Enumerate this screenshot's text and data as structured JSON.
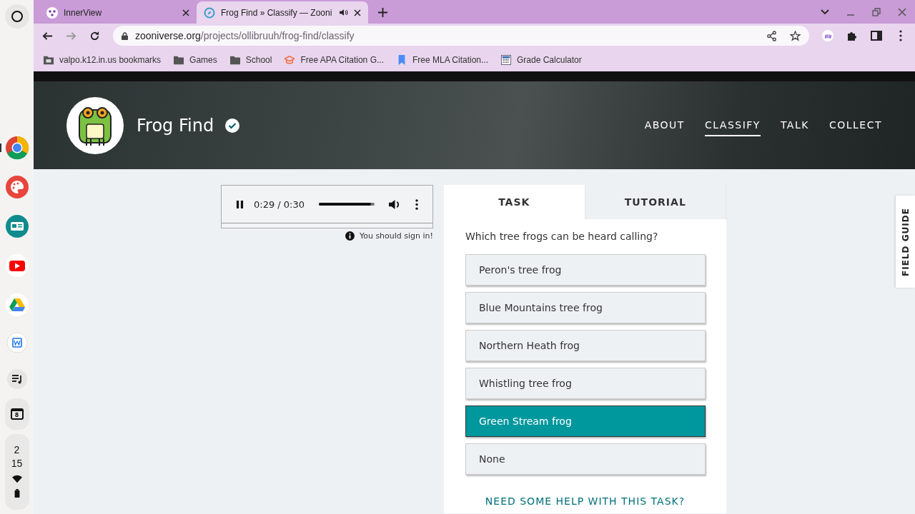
{
  "shelf": {
    "apps": [
      {
        "kind": "chrome",
        "active": true
      },
      {
        "kind": "paint",
        "active": false
      },
      {
        "kind": "news",
        "active": false
      },
      {
        "kind": "youtube",
        "active": false
      },
      {
        "kind": "drive",
        "active": false
      },
      {
        "kind": "doc",
        "active": false
      },
      {
        "kind": "playlist",
        "active": false
      }
    ],
    "calendar_day": "8",
    "clock": [
      "2",
      "15"
    ]
  },
  "browser": {
    "tabs": [
      {
        "title": "InnerView",
        "selected": false,
        "audio": false
      },
      {
        "title": "Frog Find » Classify — Zooni",
        "selected": true,
        "audio": true
      }
    ],
    "address": {
      "host": "zooniverse.org",
      "path": "/projects/ollibruuh/frog-find/classify"
    },
    "bookmarks": [
      {
        "kind": "page",
        "label": "valpo.k12.in.us bookmarks"
      },
      {
        "kind": "folder",
        "label": "Games"
      },
      {
        "kind": "folder",
        "label": "School"
      },
      {
        "kind": "cap",
        "label": "Free APA Citation G..."
      },
      {
        "kind": "ribbon",
        "label": "Free MLA Citation..."
      },
      {
        "kind": "calc",
        "label": "Grade Calculator"
      }
    ]
  },
  "project": {
    "title": "Frog Find",
    "verified": true,
    "nav": [
      {
        "label": "ABOUT",
        "selected": false
      },
      {
        "label": "CLASSIFY",
        "selected": true
      },
      {
        "label": "TALK",
        "selected": false
      },
      {
        "label": "COLLECT",
        "selected": false
      }
    ]
  },
  "player": {
    "playing": true,
    "time": "0:29 / 0:30",
    "level": 0.93
  },
  "notice": "You should sign in!",
  "task": {
    "tabs": [
      {
        "label": "TASK",
        "selected": true
      },
      {
        "label": "TUTORIAL",
        "selected": false
      }
    ],
    "question": "Which tree frogs can be heard calling?",
    "options": [
      {
        "label": "Peron's tree frog",
        "selected": false
      },
      {
        "label": "Blue Mountains tree frog",
        "selected": false
      },
      {
        "label": "Northern Heath frog",
        "selected": false
      },
      {
        "label": "Whistling tree frog",
        "selected": false
      },
      {
        "label": "Green Stream frog",
        "selected": true
      },
      {
        "label": "None",
        "selected": false
      }
    ],
    "help": "NEED SOME HELP WITH THIS TASK?"
  },
  "field_guide": "FIELD GUIDE"
}
